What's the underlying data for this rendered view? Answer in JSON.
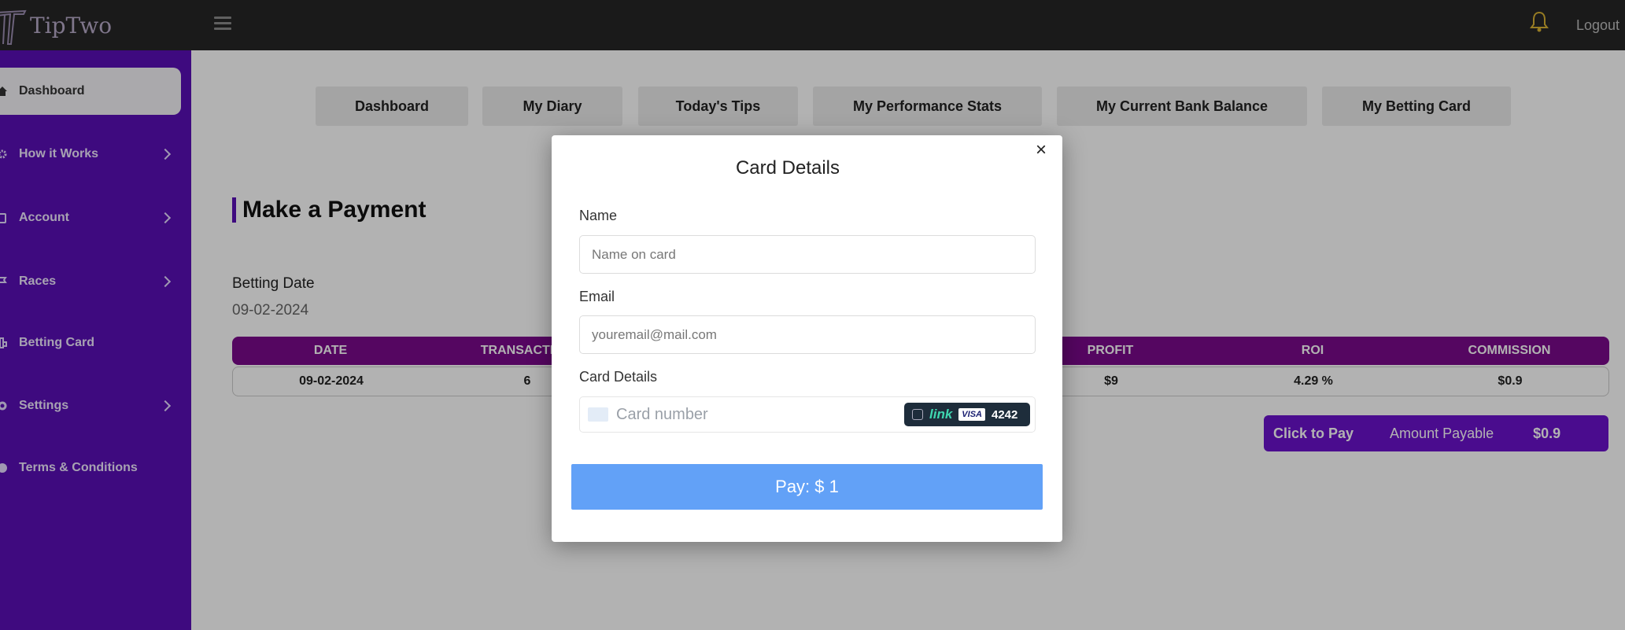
{
  "app": {
    "logo_text": "TipTwo",
    "logout_label": "Logout"
  },
  "sidebar": {
    "items": [
      {
        "label": "Dashboard",
        "icon": "home-icon",
        "active": true,
        "has_chevron": false
      },
      {
        "label": "How it Works",
        "icon": "gear-icon",
        "active": false,
        "has_chevron": true
      },
      {
        "label": "Account",
        "icon": "account-icon",
        "active": false,
        "has_chevron": true
      },
      {
        "label": "Races",
        "icon": "flag-icon",
        "active": false,
        "has_chevron": true
      },
      {
        "label": "Betting Card",
        "icon": "card-icon",
        "active": false,
        "has_chevron": false
      },
      {
        "label": "Settings",
        "icon": "settings-icon",
        "active": false,
        "has_chevron": true
      },
      {
        "label": "Terms & Conditions",
        "icon": "circle-icon",
        "active": false,
        "has_chevron": false
      }
    ]
  },
  "nav_tabs": [
    "Dashboard",
    "My Diary",
    "Today's Tips",
    "My Performance Stats",
    "My Current Bank Balance",
    "My Betting Card"
  ],
  "page": {
    "heading": "Make a Payment",
    "betting_date_label": "Betting Date",
    "betting_date_value": "09-02-2024"
  },
  "table": {
    "headers": [
      "DATE",
      "TRANSACTION",
      "PROFIT",
      "ROI",
      "COMMISSION"
    ],
    "row": [
      "09-02-2024",
      "6",
      "$9",
      "4.29 %",
      "$0.9"
    ]
  },
  "payment_bar": {
    "action_label": "Click to Pay",
    "amount_label": "Amount Payable",
    "amount_value": "$0.9"
  },
  "modal": {
    "close_glyph": "×",
    "title": "Card Details",
    "name_label": "Name",
    "name_placeholder": "Name on card",
    "email_label": "Email",
    "email_placeholder": "youremail@mail.com",
    "card_label": "Card Details",
    "card_placeholder": "Card number",
    "link_text": "link",
    "visa_text": "VISA",
    "last4": "4242",
    "pay_button": "Pay: $ 1"
  },
  "colors": {
    "sidebar": "#5a0fb6",
    "table_header": "#7a0a8c",
    "pay_button": "#62a1f7",
    "payment_bar": "#6a12cc",
    "topbar": "#262626"
  }
}
